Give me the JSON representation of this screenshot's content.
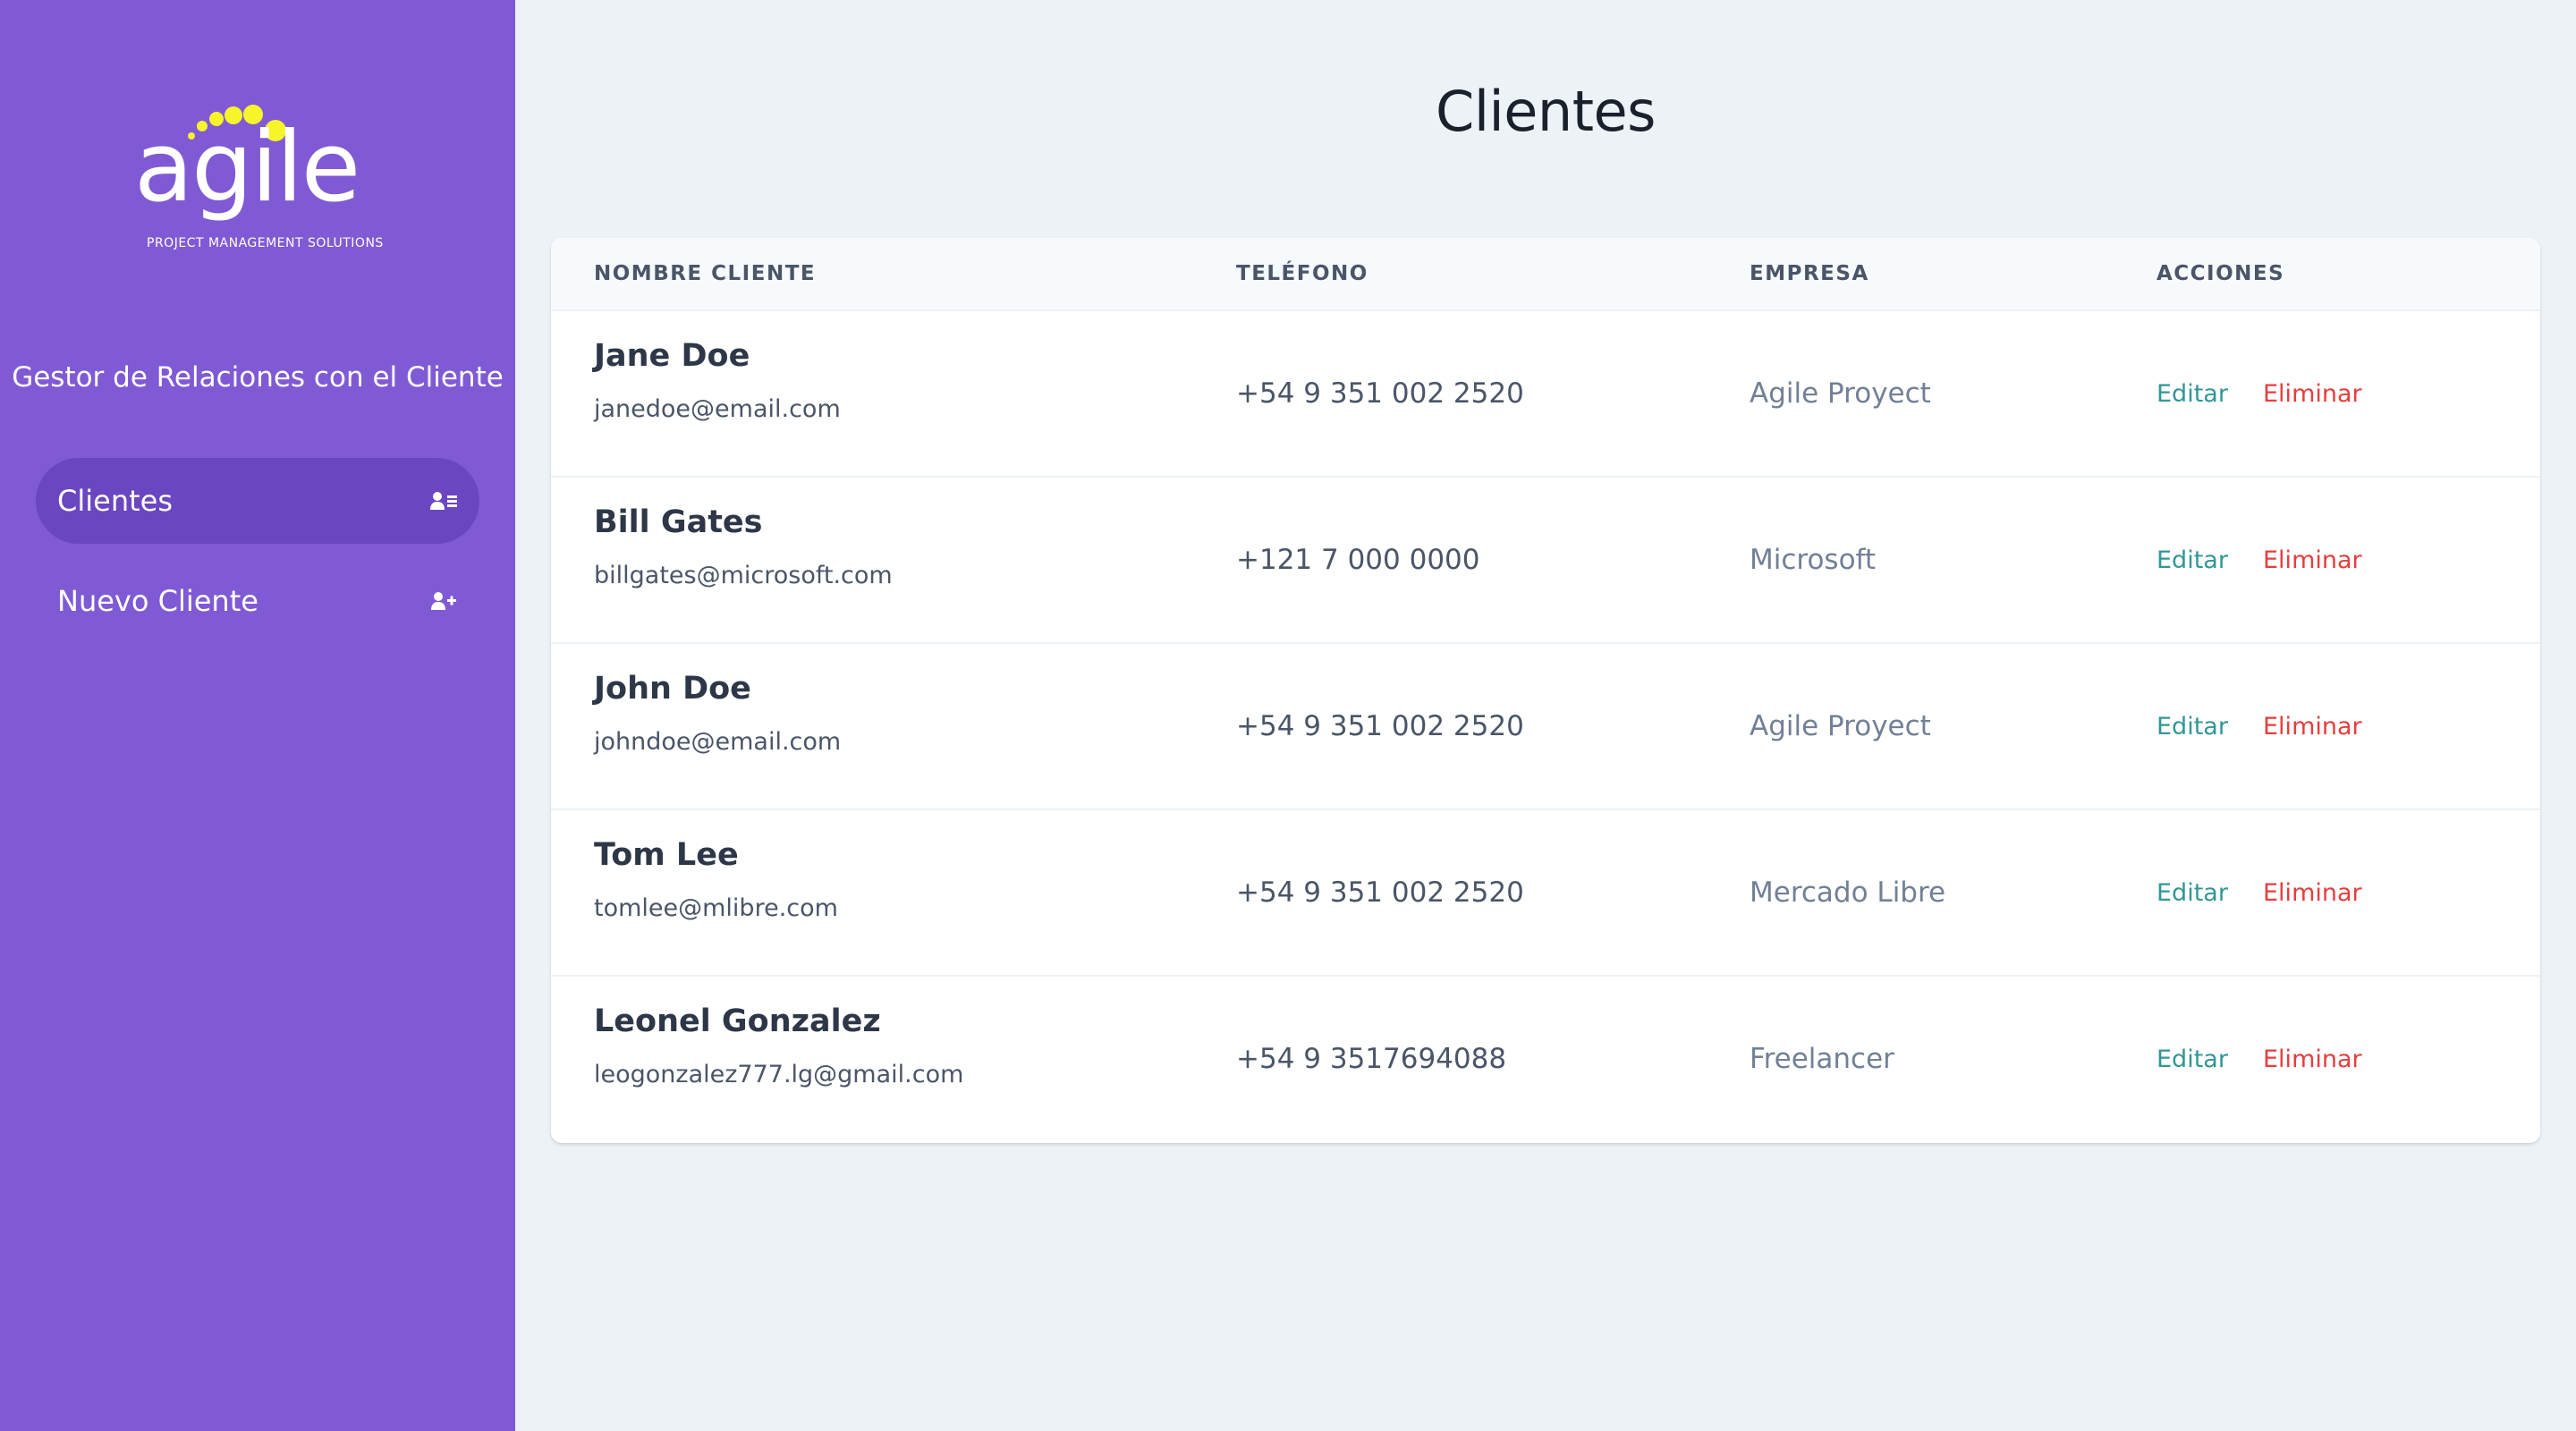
{
  "brand": {
    "logo_text": "agile",
    "logo_tagline": "PROJECT MANAGEMENT SOLUTIONS",
    "dot_color": "#f6f52a"
  },
  "sidebar": {
    "title": "Gestor de Relaciones con el Cliente",
    "background": "#805ad5",
    "active_background": "#6b46c1",
    "items": [
      {
        "label": "Clientes",
        "icon": "users-list-icon",
        "active": true
      },
      {
        "label": "Nuevo Cliente",
        "icon": "user-plus-icon",
        "active": false
      }
    ]
  },
  "main": {
    "title": "Clientes",
    "table": {
      "headers": [
        "NOMBRE CLIENTE",
        "TELÉFONO",
        "EMPRESA",
        "ACCIONES"
      ],
      "rows": [
        {
          "name": "Jane Doe",
          "email": "janedoe@email.com",
          "phone": "+54 9 351 002 2520",
          "company": "Agile Proyect",
          "edit": "Editar",
          "delete": "Eliminar"
        },
        {
          "name": "Bill Gates",
          "email": "billgates@microsoft.com",
          "phone": "+121 7 000 0000",
          "company": "Microsoft",
          "edit": "Editar",
          "delete": "Eliminar"
        },
        {
          "name": "John Doe",
          "email": "johndoe@email.com",
          "phone": "+54 9 351 002 2520",
          "company": "Agile Proyect",
          "edit": "Editar",
          "delete": "Eliminar"
        },
        {
          "name": "Tom Lee",
          "email": "tomlee@mlibre.com",
          "phone": "+54 9 351 002 2520",
          "company": "Mercado Libre",
          "edit": "Editar",
          "delete": "Eliminar"
        },
        {
          "name": "Leonel Gonzalez",
          "email": "leogonzalez777.lg@gmail.com",
          "phone": "+54 9 3517694088",
          "company": "Freelancer",
          "edit": "Editar",
          "delete": "Eliminar"
        }
      ]
    },
    "colors": {
      "edit": "#319795",
      "delete": "#e53e3e"
    }
  }
}
